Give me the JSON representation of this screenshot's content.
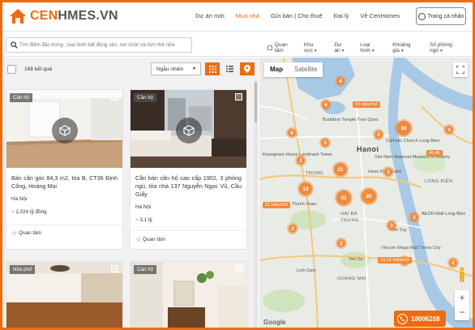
{
  "brand": {
    "name_pre": "CEN",
    "name_post": "H",
    "name_tail": "MES.VN"
  },
  "nav": {
    "items": [
      "Dự án mới",
      "Mua nhà",
      "Gửi bán | Cho thuê",
      "Đại lý",
      "Về CenHomes"
    ],
    "active_index": 1
  },
  "account": {
    "label": "Trang cá nhân"
  },
  "search": {
    "placeholder": "Tìm điểm đặc trưng , loại hình bất động sản, nơi chốn và hơn thế nữa"
  },
  "filters": {
    "favorite": "Quan tâm",
    "items": [
      "Khu vực",
      "Dự án",
      "Loại hình",
      "Khoảng giá",
      "Số phòng ngủ"
    ]
  },
  "list": {
    "count_label": "168 kết quả",
    "sort_label": "Ngẫu nhiên",
    "cards": [
      {
        "badge": "Căn hộ",
        "title": "Bán căn góc 84,3 m2, tòa B, CT36 Định Công, Hoàng Mai",
        "location": "Hà Nội",
        "price": "~ 2,024 tỷ đồng",
        "save": "Quan tâm"
      },
      {
        "badge": "Căn hộ",
        "title": "Cần bán căn hộ cao cấp 1902, 3 phòng ngủ, tòa nhà 137 Nguyễn Ngọc Vũ, Cầu Giấy",
        "location": "Hà Nội",
        "price": "~ 3,1 tỷ",
        "save": "Quan tâm"
      },
      {
        "badge": "Nhà phố"
      },
      {
        "badge": "Căn hộ"
      }
    ]
  },
  "map": {
    "tabs": [
      "Map",
      "Satellite"
    ],
    "clusters": [
      "4",
      "6",
      "16",
      "6",
      "2",
      "4",
      "3",
      "2",
      "21",
      "12",
      "31",
      "25",
      "2",
      "3",
      "2",
      "2",
      "2",
      "2",
      "2"
    ],
    "price_tags": [
      "66 triệu/m2",
      "45,45",
      "21 triệu/m2",
      "19,12 triệu/m2"
    ],
    "places": {
      "hanoi": "Hanoi",
      "trung": "TRUNG",
      "dist1": "HAI BÀ",
      "dist2": "TRƯNG",
      "keangnam": "Keangnam Hanoi Landmark Tower",
      "buddhist": "Buddhist Temple Tran Quoc",
      "catholic": "Catholic Church Long Bien",
      "hoan": "Hoan Kiem Lake",
      "vinh": "Vinh Tuy",
      "longbien": "LONG BIÊN",
      "hoangmai": "HOÀNG MAI",
      "thanh": "Thanh Xuan",
      "vincom": "Vincom Mega Mall Times City",
      "viet": "Viet Nam National Museum of History",
      "aeon": "AEON Mall Long Bien",
      "linh": "Linh Dam",
      "yen": "Yen So"
    },
    "attribution": "Google",
    "hotline": "18006268"
  },
  "colors": {
    "accent": "#f06a0f",
    "cluster": "#f08a3c"
  }
}
